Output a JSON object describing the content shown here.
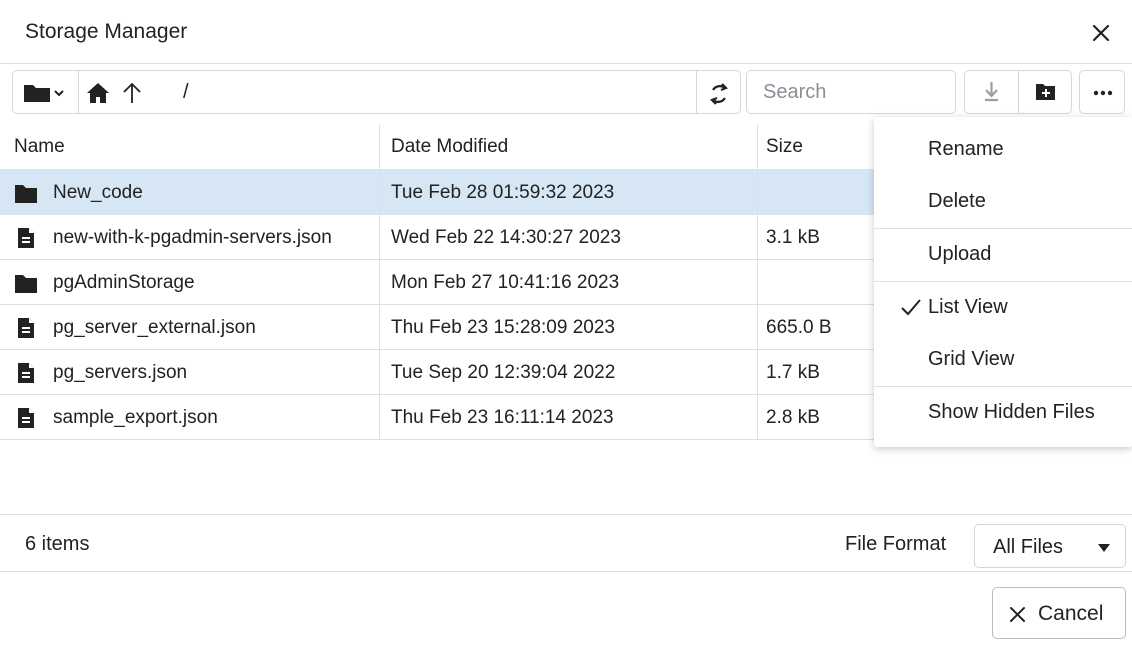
{
  "dialog": {
    "title": "Storage Manager"
  },
  "toolbar": {
    "path": "/",
    "search_placeholder": "Search"
  },
  "grid": {
    "columns": [
      "Name",
      "Date Modified",
      "Size"
    ],
    "rows": [
      {
        "type": "folder",
        "name": "New_code",
        "modified": "Tue Feb 28 01:59:32 2023",
        "size": "",
        "selected": true
      },
      {
        "type": "file",
        "name": "new-with-k-pgadmin-servers.json",
        "modified": "Wed Feb 22 14:30:27 2023",
        "size": "3.1 kB",
        "selected": false
      },
      {
        "type": "folder",
        "name": "pgAdminStorage",
        "modified": "Mon Feb 27 10:41:16 2023",
        "size": "",
        "selected": false
      },
      {
        "type": "file",
        "name": "pg_server_external.json",
        "modified": "Thu Feb 23 15:28:09 2023",
        "size": "665.0 B",
        "selected": false
      },
      {
        "type": "file",
        "name": "pg_servers.json",
        "modified": "Tue Sep 20 12:39:04 2022",
        "size": "1.7 kB",
        "selected": false
      },
      {
        "type": "file",
        "name": "sample_export.json",
        "modified": "Thu Feb 23 16:11:14 2023",
        "size": "2.8 kB",
        "selected": false
      }
    ]
  },
  "context_menu": {
    "items": [
      {
        "label": "Rename",
        "checked": false
      },
      {
        "label": "Delete",
        "checked": false
      },
      {
        "label": "Upload",
        "checked": false
      },
      {
        "label": "List View",
        "checked": true
      },
      {
        "label": "Grid View",
        "checked": false
      },
      {
        "label": "Show Hidden Files",
        "checked": false
      }
    ]
  },
  "footer": {
    "item_count": "6 items",
    "file_format_label": "File Format",
    "file_format_value": "All Files"
  },
  "buttons": {
    "cancel": "Cancel"
  },
  "colors": {
    "selected_row": "#d6e6f5",
    "border": "#dde0e6",
    "icon": "#222222"
  },
  "icons": {
    "close": "close-icon",
    "folder_dropdown": "folder-icon",
    "home": "home-icon",
    "up": "arrow-up-icon",
    "refresh": "refresh-icon",
    "download": "download-icon",
    "new_folder": "new-folder-icon",
    "more": "ellipsis-icon",
    "file": "file-icon",
    "check": "check-icon",
    "caret": "caret-down-icon",
    "cancel": "close-icon"
  }
}
